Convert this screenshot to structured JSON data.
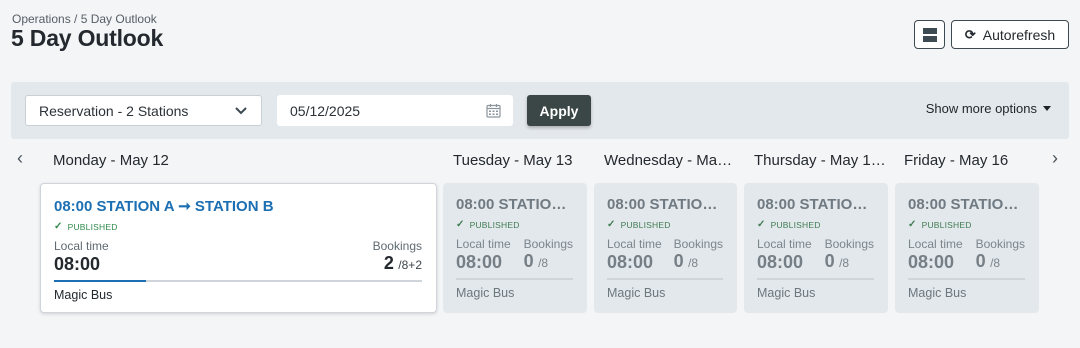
{
  "breadcrumb": "Operations / 5 Day Outlook",
  "title": "5 Day Outlook",
  "header": {
    "layout_icon": "layout-rows-icon",
    "refresh_icon": "refresh-icon",
    "refresh_label": "Autorefresh"
  },
  "filters": {
    "reservation_value": "Reservation - 2 Stations",
    "date_value": "05/12/2025",
    "apply_label": "Apply",
    "more_options_label": "Show more options"
  },
  "nav": {
    "prev": "‹",
    "next": "›"
  },
  "days": [
    {
      "label": "Monday - May 12",
      "route": "08:00 STATION A ➞ STATION B",
      "status": "PUBLISHED",
      "local_time_label": "Local time",
      "local_time": "08:00",
      "bookings_label": "Bookings",
      "bookings": "2",
      "bookings_detail": "/8+2",
      "progress": 0.25,
      "vehicle": "Magic Bus"
    },
    {
      "label": "Tuesday - May 13",
      "route": "08:00 STATION…",
      "status": "PUBLISHED",
      "local_time_label": "Local time",
      "local_time": "08:00",
      "bookings_label": "Bookings",
      "bookings": "0",
      "bookings_detail": "/8",
      "vehicle": "Magic Bus"
    },
    {
      "label": "Wednesday - Ma…",
      "route": "08:00 STATION…",
      "status": "PUBLISHED",
      "local_time_label": "Local time",
      "local_time": "08:00",
      "bookings_label": "Bookings",
      "bookings": "0",
      "bookings_detail": "/8",
      "vehicle": "Magic Bus"
    },
    {
      "label": "Thursday - May 1…",
      "route": "08:00 STATION…",
      "status": "PUBLISHED",
      "local_time_label": "Local time",
      "local_time": "08:00",
      "bookings_label": "Bookings",
      "bookings": "0",
      "bookings_detail": "/8",
      "vehicle": "Magic Bus"
    },
    {
      "label": "Friday - May 16",
      "route": "08:00 STATION…",
      "status": "PUBLISHED",
      "local_time_label": "Local time",
      "local_time": "08:00",
      "bookings_label": "Bookings",
      "bookings": "0",
      "bookings_detail": "/8",
      "vehicle": "Magic Bus"
    }
  ],
  "colors": {
    "accent": "#1c6fb2",
    "published": "#2f8a4c",
    "apply": "#3a4746"
  }
}
